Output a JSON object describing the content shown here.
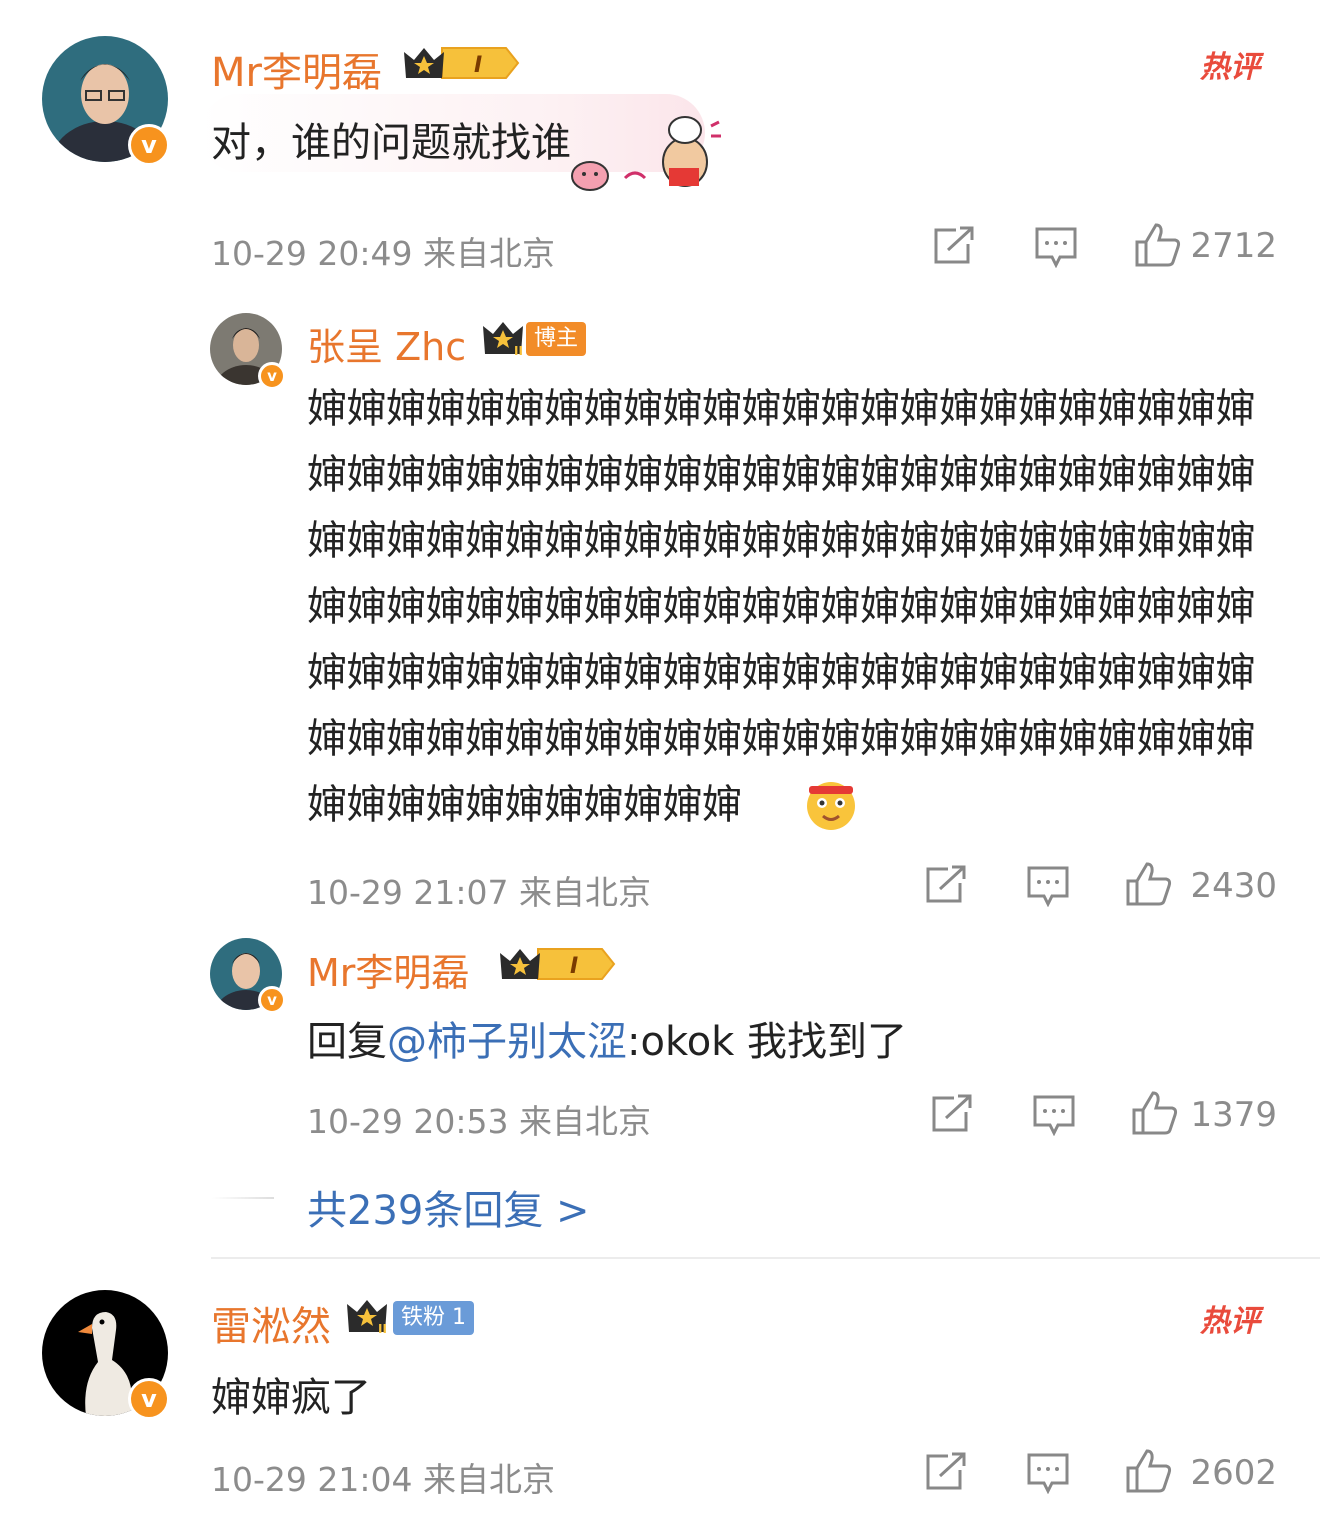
{
  "comments": [
    {
      "user": "Mr李明磊",
      "level": "I",
      "text": "对，谁的问题就找谁",
      "meta": "10-29 20:49 来自北京",
      "likes": "2712",
      "hot": "热评"
    },
    {
      "user": "雷淞然",
      "badge": "铁粉 1",
      "text": "婶婶疯了",
      "meta": "10-29 21:04 来自北京",
      "likes": "2602",
      "hot": "热评"
    }
  ],
  "replies": [
    {
      "user": "张呈 Zhc",
      "badge": "博主",
      "level": "II",
      "text": "婶婶婶婶婶婶婶婶婶婶婶婶婶婶婶婶婶婶婶婶婶婶婶婶婶婶婶婶婶婶婶婶婶婶婶婶婶婶婶婶婶婶婶婶婶婶婶婶婶婶婶婶婶婶婶婶婶婶婶婶婶婶婶婶婶婶婶婶婶婶婶婶婶婶婶婶婶婶婶婶婶婶婶婶婶婶婶婶婶婶婶婶婶婶婶婶婶婶婶婶婶婶婶婶婶婶婶婶婶婶婶婶婶婶婶婶婶婶婶婶婶婶婶婶婶婶婶婶婶婶婶婶婶婶婶婶婶婶婶婶婶婶婶婶婶婶婶婶婶婶婶婶婶婶婶",
      "meta": "10-29 21:07 来自北京",
      "likes": "2430"
    },
    {
      "user": "Mr李明磊",
      "level": "I",
      "reply_prefix": "回复",
      "mention": "@柿子别太涩",
      "reply_text": ":okok 我找到了",
      "meta": "10-29 20:53 来自北京",
      "likes": "1379"
    }
  ],
  "more_replies": "共239条回复 >",
  "colors": {
    "username": "#e8762d",
    "link": "#3b6fb6",
    "hot": "#e94b3c",
    "meta": "#8c8c8c"
  }
}
